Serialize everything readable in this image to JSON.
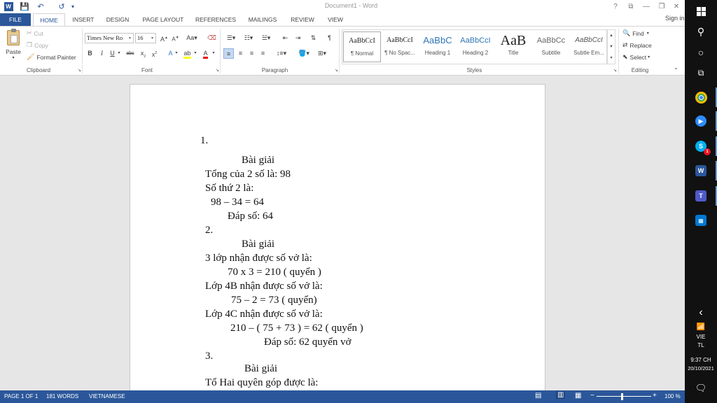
{
  "window": {
    "title": "Document1 - Word",
    "controls": {
      "help": "?",
      "options": "⧉",
      "minimize": "—",
      "restore": "❐",
      "close": "✕"
    }
  },
  "quick_access": {
    "save": "💾",
    "undo": "↶",
    "redo": "↺",
    "customize": "▾"
  },
  "tabs": [
    "FILE",
    "HOME",
    "INSERT",
    "DESIGN",
    "PAGE LAYOUT",
    "REFERENCES",
    "MAILINGS",
    "REVIEW",
    "VIEW"
  ],
  "signin": "Sign in",
  "ribbon": {
    "clipboard": {
      "label": "Clipboard",
      "paste": "Paste",
      "cut": "Cut",
      "copy": "Copy",
      "format_painter": "Format Painter"
    },
    "font": {
      "label": "Font",
      "name": "Times New Ro",
      "size": "16"
    },
    "paragraph": {
      "label": "Paragraph"
    },
    "styles": {
      "label": "Styles",
      "items": [
        {
          "preview": "AaBbCcI",
          "name": "¶ Normal"
        },
        {
          "preview": "AaBbCcI",
          "name": "¶ No Spac..."
        },
        {
          "preview": "AaBbC",
          "name": "Heading 1"
        },
        {
          "preview": "AaBbCcI",
          "name": "Heading 2"
        },
        {
          "preview": "AaB",
          "name": "Title"
        },
        {
          "preview": "AaBbCc",
          "name": "Subtitle"
        },
        {
          "preview": "AaBbCcI",
          "name": "Subtle Em..."
        }
      ]
    },
    "editing": {
      "label": "Editing",
      "find": "Find",
      "replace": "Replace",
      "select": "Select"
    }
  },
  "document": {
    "lines": [
      "1.",
      "Bài giải",
      "Tổng của 2 số là: 98",
      "Số thứ 2 là:",
      "98 – 34 = 64",
      "Đáp số: 64",
      "2.",
      "Bài giải",
      "3 lớp nhận được số vở là:",
      "70 x 3 = 210 ( quyển )",
      "Lớp 4B nhận được số vở là:",
      "75 – 2 = 73 ( quyển)",
      "Lớp 4C nhận được số vở là:",
      "210 – ( 75 + 73 ) = 62 ( quyển )",
      "Đáp số: 62 quyển vở",
      "3.",
      "Bài giải",
      "Tổ Hai quyên góp được là:"
    ]
  },
  "status": {
    "page": "PAGE 1 OF 1",
    "words": "181 WORDS",
    "language": "VIETNAMESE",
    "zoom_minus": "−",
    "zoom_plus": "+",
    "zoom": "100 %"
  },
  "taskbar": {
    "notifications_badge": "1",
    "expand": "‹",
    "input_lang_1": "VIE",
    "input_lang_2": "TL",
    "time": "9:37 CH",
    "date": "20/10/2021"
  },
  "colors": {
    "word_blue": "#2b579a",
    "taskbar": "#111111",
    "skype": "#00aff0",
    "zoom": "#2d8cff",
    "teams": "#5059c9",
    "chrome_green": "#34a853",
    "calc": "#0078d4"
  }
}
